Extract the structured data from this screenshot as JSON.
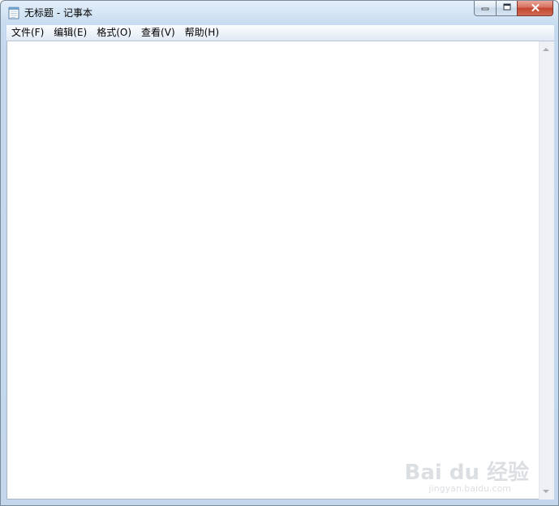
{
  "window": {
    "title": "无标题 - 记事本"
  },
  "caption_buttons": {
    "minimize_icon": "minimize-icon",
    "maximize_icon": "restore-icon",
    "close_icon": "close-icon",
    "minimize_glyph": "▭",
    "maximize_glyph": "❐",
    "close_glyph": "✕"
  },
  "menu": {
    "items": [
      {
        "label": "文件(F)"
      },
      {
        "label": "编辑(E)"
      },
      {
        "label": "格式(O)"
      },
      {
        "label": "查看(V)"
      },
      {
        "label": "帮助(H)"
      }
    ]
  },
  "editor": {
    "content": ""
  },
  "watermark": {
    "logo": "Bai du 经验",
    "url": "jingyan.baidu.com"
  },
  "colors": {
    "frame": "#c4d9ee",
    "close_button": "#c2452f",
    "editor_bg": "#ffffff"
  }
}
